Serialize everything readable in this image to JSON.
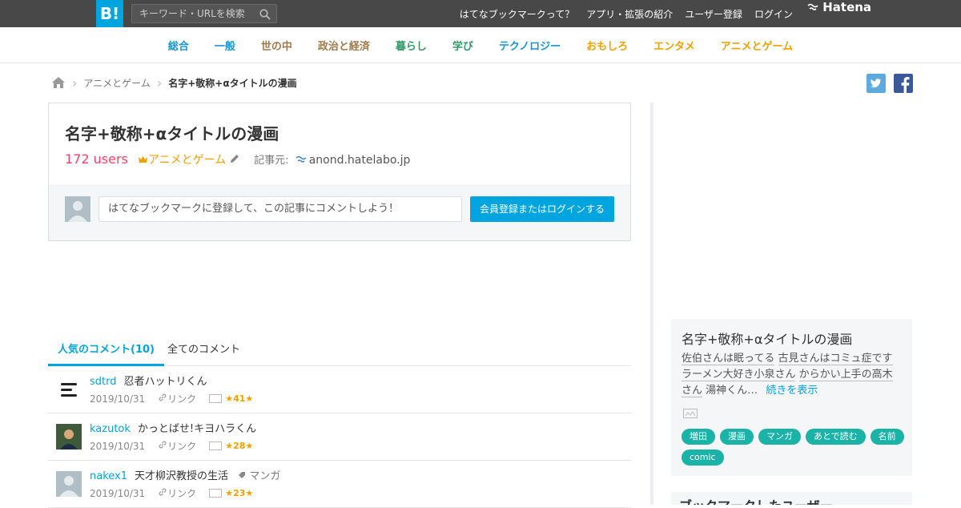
{
  "header": {
    "logo": "B!",
    "search_placeholder": "キーワード・URLを検索",
    "links": [
      "はてなブックマークって？",
      "アプリ・拡張の紹介",
      "ユーザー登録",
      "ログイン"
    ],
    "brand": "Hatena"
  },
  "categories": [
    {
      "label": "総合",
      "color": "#1994d3"
    },
    {
      "label": "一般",
      "color": "#1994d3"
    },
    {
      "label": "世の中",
      "color": "#a1794c"
    },
    {
      "label": "政治と経済",
      "color": "#a1794c"
    },
    {
      "label": "暮らし",
      "color": "#339966"
    },
    {
      "label": "学び",
      "color": "#339966"
    },
    {
      "label": "テクノロジー",
      "color": "#1994d3"
    },
    {
      "label": "おもしろ",
      "color": "#f0a000"
    },
    {
      "label": "エンタメ",
      "color": "#f0a000"
    },
    {
      "label": "アニメとゲーム",
      "color": "#f0a000"
    }
  ],
  "breadcrumb": {
    "category": "アニメとゲーム",
    "current": "名字+敬称+αタイトルの漫画"
  },
  "entry": {
    "title": "名字+敬称+αタイトルの漫画",
    "users": "172 users",
    "category": "アニメとゲーム",
    "source_label": "記事元:",
    "source": "anond.hatelabo.jp",
    "comment_placeholder": "はてなブックマークに登録して、この記事にコメントしよう！",
    "login_button": "会員登録またはログインする"
  },
  "tabs": {
    "popular": "人気のコメント(10)",
    "all": "全てのコメント"
  },
  "comments": [
    {
      "user": "sdtrd",
      "text": "忍者ハットリくん",
      "tag": "",
      "date": "2019/10/31",
      "link": "リンク",
      "stars": "41"
    },
    {
      "user": "kazutok",
      "text": "かっとばせ!キヨハラくん",
      "tag": "",
      "date": "2019/10/31",
      "link": "リンク",
      "stars": "28"
    },
    {
      "user": "nakex1",
      "text": "天才柳沢教授の生活",
      "tag": "マンガ",
      "date": "2019/10/31",
      "link": "リンク",
      "stars": "23"
    }
  ],
  "sidebar": {
    "title": "名字+敬称+αタイトルの漫画",
    "desc_parts": [
      "佐伯さんは眠ってる",
      "古見さんはコミュ症です",
      "ラーメン大好き小泉さん",
      "からかい上手の高木さん",
      "湯神くん…"
    ],
    "more": "続きを表示",
    "tags": [
      "増田",
      "漫画",
      "マンガ",
      "あとで読む",
      "名前",
      "comic"
    ],
    "users_heading": "ブックマークしたユーザー"
  }
}
